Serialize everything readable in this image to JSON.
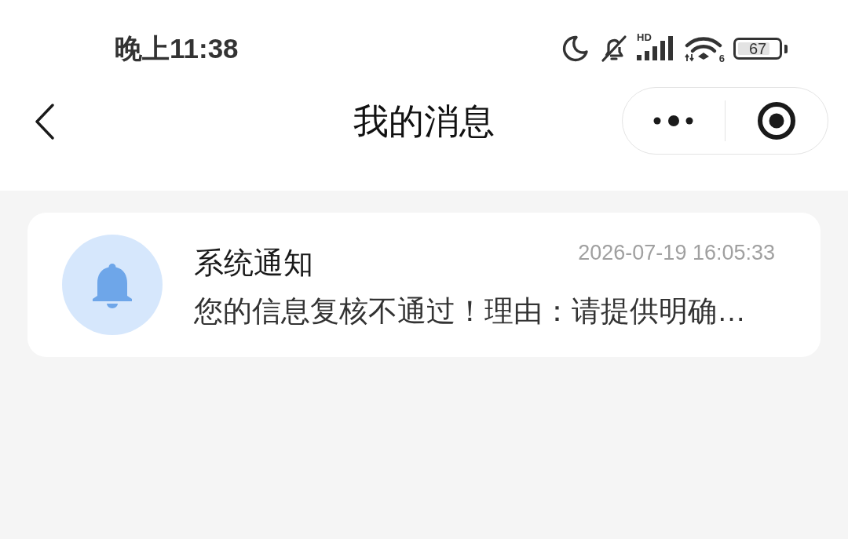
{
  "status_bar": {
    "time": "晚上11:38",
    "network_type": "HD",
    "wifi_standard": "6",
    "battery": "67"
  },
  "nav_bar": {
    "title": "我的消息"
  },
  "messages": [
    {
      "title": "系统通知",
      "time": "2026-07-19 16:05:33",
      "preview": "您的信息复核不通过！理由：请提供明确…"
    }
  ]
}
